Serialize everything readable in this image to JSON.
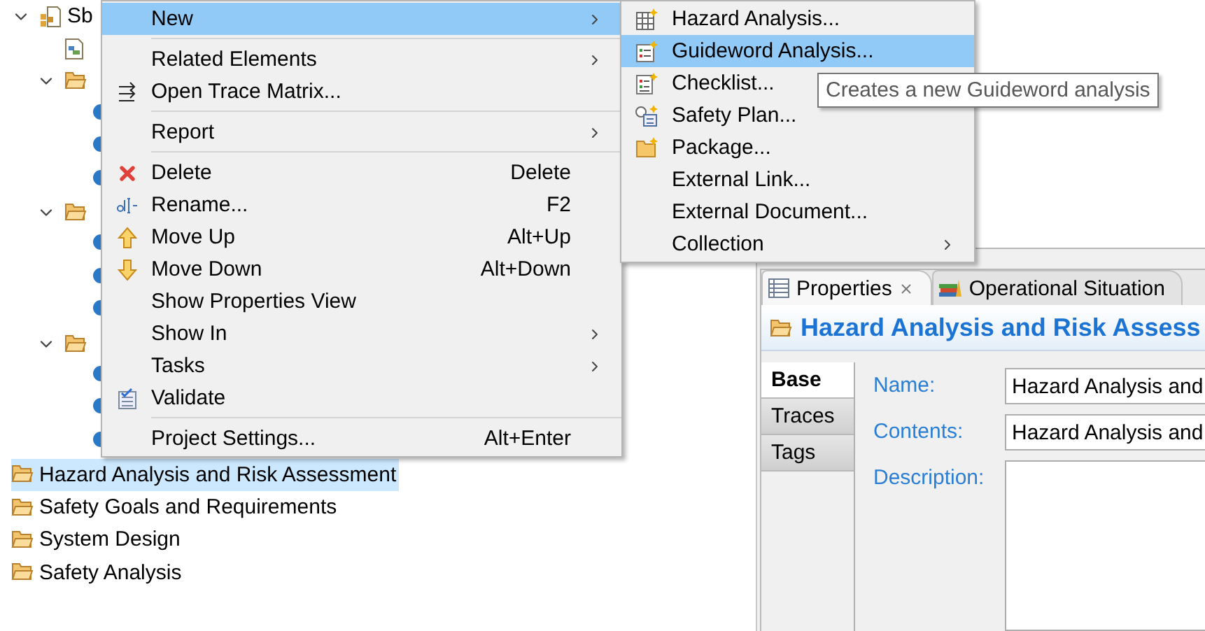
{
  "tree": [
    {
      "kind": "project",
      "label": "Sb",
      "expanded": true,
      "selected": false,
      "children": [
        {
          "kind": "file"
        },
        {
          "kind": "folder",
          "expanded": true,
          "children": [
            {
              "kind": "element"
            },
            {
              "kind": "element"
            },
            {
              "kind": "element"
            }
          ]
        },
        {
          "kind": "folder",
          "expanded": true,
          "children": [
            {
              "kind": "element"
            },
            {
              "kind": "element"
            },
            {
              "kind": "element"
            }
          ]
        },
        {
          "kind": "folder",
          "expanded": true,
          "children": [
            {
              "kind": "element"
            },
            {
              "kind": "element"
            },
            {
              "kind": "element"
            }
          ]
        }
      ]
    },
    {
      "kind": "folder",
      "label": "Hazard Analysis and Risk Assessment",
      "selected": true
    },
    {
      "kind": "folder",
      "label": "Safety Goals and Requirements",
      "selected": false
    },
    {
      "kind": "folder",
      "label": "System Design",
      "selected": false
    },
    {
      "kind": "folder",
      "label": "Safety Analysis",
      "selected": false
    }
  ],
  "context_menu": [
    {
      "kind": "item",
      "label": "New",
      "has_submenu": true,
      "selected": true
    },
    {
      "kind": "separator"
    },
    {
      "kind": "item",
      "label": "Related Elements",
      "has_submenu": true,
      "selected": false
    },
    {
      "kind": "item",
      "label": "Open Trace Matrix...",
      "has_submenu": false,
      "selected": false
    },
    {
      "kind": "separator"
    },
    {
      "kind": "item",
      "label": "Report",
      "has_submenu": true,
      "selected": false
    },
    {
      "kind": "separator"
    },
    {
      "kind": "item",
      "label": "Delete",
      "shortcut": "Delete",
      "has_submenu": false,
      "selected": false
    },
    {
      "kind": "item",
      "label": "Rename...",
      "shortcut": "F2",
      "has_submenu": false,
      "selected": false
    },
    {
      "kind": "item",
      "label": "Move Up",
      "shortcut": "Alt+Up",
      "has_submenu": false,
      "selected": false
    },
    {
      "kind": "item",
      "label": "Move Down",
      "shortcut": "Alt+Down",
      "has_submenu": false,
      "selected": false
    },
    {
      "kind": "item",
      "label": "Show Properties View",
      "has_submenu": false,
      "selected": false
    },
    {
      "kind": "item",
      "label": "Show In",
      "has_submenu": true,
      "selected": false
    },
    {
      "kind": "item",
      "label": "Tasks",
      "has_submenu": true,
      "selected": false
    },
    {
      "kind": "item",
      "label": "Validate",
      "has_submenu": false,
      "selected": false
    },
    {
      "kind": "separator"
    },
    {
      "kind": "item",
      "label": "Project Settings...",
      "shortcut": "Alt+Enter",
      "has_submenu": false,
      "selected": false
    }
  ],
  "submenu": [
    {
      "kind": "item",
      "label": "Hazard Analysis...",
      "has_submenu": false,
      "selected": false
    },
    {
      "kind": "item",
      "label": "Guideword Analysis...",
      "has_submenu": false,
      "selected": true
    },
    {
      "kind": "item",
      "label": "Checklist...",
      "has_submenu": false,
      "selected": false
    },
    {
      "kind": "item",
      "label": "Safety Plan...",
      "has_submenu": false,
      "selected": false
    },
    {
      "kind": "item",
      "label": "Package...",
      "has_submenu": false,
      "selected": false
    },
    {
      "kind": "item",
      "label": "External Link...",
      "has_submenu": false,
      "selected": false
    },
    {
      "kind": "item",
      "label": "External Document...",
      "has_submenu": false,
      "selected": false
    },
    {
      "kind": "item",
      "label": "Collection",
      "has_submenu": true,
      "selected": false
    }
  ],
  "tooltip": {
    "text": "Creates a new Guideword analysis"
  },
  "properties": {
    "tabs": [
      {
        "label": "Properties",
        "selected": true,
        "closable": true
      },
      {
        "label": "Operational Situation",
        "selected": false,
        "closable": false
      }
    ],
    "title": "Hazard Analysis and Risk Assess",
    "side_tabs": [
      {
        "label": "Base",
        "selected": true
      },
      {
        "label": "Traces",
        "selected": false
      },
      {
        "label": "Tags",
        "selected": false
      }
    ],
    "fields": [
      {
        "kind": "line",
        "label": "Name:",
        "value": "Hazard Analysis and"
      },
      {
        "kind": "line",
        "label": "Contents:",
        "value": "Hazard Analysis and"
      },
      {
        "kind": "area",
        "label": "Description:"
      }
    ]
  }
}
